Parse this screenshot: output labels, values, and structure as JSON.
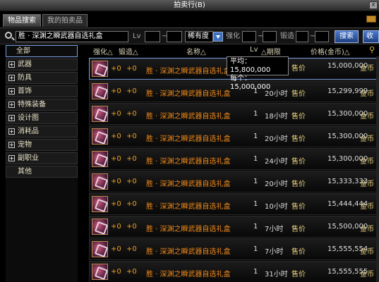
{
  "window": {
    "title": "拍卖行(B)",
    "close_label": "x"
  },
  "tabs": [
    {
      "label": "物品搜索",
      "active": true
    },
    {
      "label": "我的拍卖品",
      "active": false
    }
  ],
  "search": {
    "query": "胜 · 深渊之瞬武器自选礼盒",
    "lv_label": "Lv",
    "lv_min": "",
    "lv_max": "",
    "tilde": "~",
    "rarity_value": "稀有度",
    "strength_label": "强化",
    "strength_min": "",
    "strength_max": "",
    "forge_label": "锻造",
    "forge_min": "",
    "forge_max": "",
    "search_button": "搜索",
    "favorite_button": "收"
  },
  "sidebar": {
    "items": [
      {
        "label": "全部",
        "expandable": false
      },
      {
        "label": "武器",
        "expandable": true
      },
      {
        "label": "防具",
        "expandable": true
      },
      {
        "label": "首饰",
        "expandable": true
      },
      {
        "label": "特殊装备",
        "expandable": true
      },
      {
        "label": "设计图",
        "expandable": true
      },
      {
        "label": "消耗品",
        "expandable": true
      },
      {
        "label": "宠物",
        "expandable": true
      },
      {
        "label": "副职业",
        "expandable": true
      },
      {
        "label": "其他",
        "expandable": false
      }
    ]
  },
  "table": {
    "headers": {
      "strength": "强化△",
      "forge": "锻造△",
      "name": "名称△",
      "lv": "Lv",
      "time": "△期限",
      "price": "价格(金币)△"
    },
    "rows": [
      {
        "strength": "+0",
        "forge": "+0",
        "name": "胜 · 深渊之瞬武器自选礼盒",
        "lv": "1",
        "time": "",
        "sell": "售价",
        "price": "15,000,000",
        "unit": "金币"
      },
      {
        "strength": "+0",
        "forge": "+0",
        "name": "胜 · 深渊之瞬武器自选礼盒",
        "lv": "1",
        "time": "20小时",
        "sell": "售价",
        "price": "15,299,999",
        "unit": "金币"
      },
      {
        "strength": "+0",
        "forge": "+0",
        "name": "胜 · 深渊之瞬武器自选礼盒",
        "lv": "1",
        "time": "18小时",
        "sell": "售价",
        "price": "15,300,000",
        "unit": "金币"
      },
      {
        "strength": "+0",
        "forge": "+0",
        "name": "胜 · 深渊之瞬武器自选礼盒",
        "lv": "1",
        "time": "20小时",
        "sell": "售价",
        "price": "15,300,000",
        "unit": "金币"
      },
      {
        "strength": "+0",
        "forge": "+0",
        "name": "胜 · 深渊之瞬武器自选礼盒",
        "lv": "1",
        "time": "24小时",
        "sell": "售价",
        "price": "15,300,000",
        "unit": "金币"
      },
      {
        "strength": "+0",
        "forge": "+0",
        "name": "胜 · 深渊之瞬武器自选礼盒",
        "lv": "1",
        "time": "20小时",
        "sell": "售价",
        "price": "15,333,333",
        "unit": "金币"
      },
      {
        "strength": "+0",
        "forge": "+0",
        "name": "胜 · 深渊之瞬武器自选礼盒",
        "lv": "1",
        "time": "10小时",
        "sell": "售价",
        "price": "15,444,444",
        "unit": "金币"
      },
      {
        "strength": "+0",
        "forge": "+0",
        "name": "胜 · 深渊之瞬武器自选礼盒",
        "lv": "1",
        "time": "7小时",
        "sell": "售价",
        "price": "15,500,000",
        "unit": "金币"
      },
      {
        "strength": "+0",
        "forge": "+0",
        "name": "胜 · 深渊之瞬武器自选礼盒",
        "lv": "1",
        "time": "7小时",
        "sell": "售价",
        "price": "15,555,554",
        "unit": "金币"
      },
      {
        "strength": "+0",
        "forge": "+0",
        "name": "胜 · 深渊之瞬武器自选礼盒",
        "lv": "1",
        "time": "31小时",
        "sell": "售价",
        "price": "15,555,555",
        "unit": "金币"
      }
    ]
  },
  "tooltip": {
    "avg": "平均：15,800,000",
    "each": "每个：15,000,000"
  },
  "colors": {
    "name_orange": "#f08a1a",
    "enhance_orange": "#f0a020",
    "sell_gold": "#e8d080",
    "select_blue": "#7aa0e0"
  }
}
